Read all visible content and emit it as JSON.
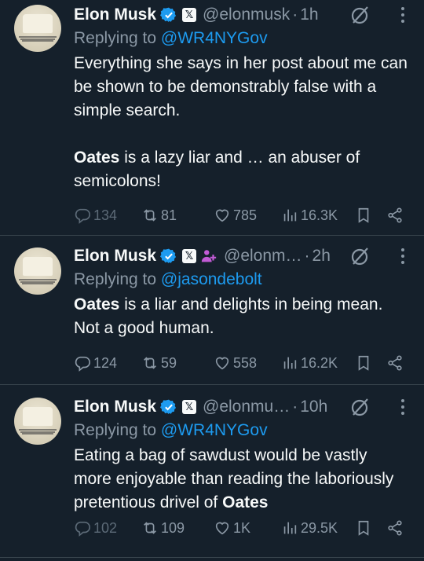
{
  "colors": {
    "background": "#15202b",
    "text": "#f7f9f9",
    "muted": "#8b98a5",
    "link": "#1d9bf0",
    "divider": "#38444d",
    "verified": "#1d9bf0"
  },
  "tweets": [
    {
      "author": "Elon Musk",
      "handle": "@elonmusk",
      "time": "1h",
      "separator": "·",
      "badges": [
        "verified-icon",
        "x-affiliate-icon"
      ],
      "reply_prefix": "Replying to ",
      "reply_to": "@WR4NYGov",
      "body_parts": [
        "Everything she says in her post about me can be shown to be demonstrably false with a simple search.",
        "Oates",
        " is a lazy liar and … an abuser of semicolons!"
      ],
      "stats": {
        "replies": "134",
        "retweets": "81",
        "likes": "785",
        "views": "16.3K"
      }
    },
    {
      "author": "Elon Musk",
      "handle": "@elonm…",
      "time": "2h",
      "separator": "·",
      "badges": [
        "verified-icon",
        "x-affiliate-icon",
        "group-icon"
      ],
      "reply_prefix": "Replying to ",
      "reply_to": "@jasondebolt",
      "body_parts": [
        "Oates",
        " is a liar and delights in being mean. Not a good human."
      ],
      "stats": {
        "replies": "124",
        "retweets": "59",
        "likes": "558",
        "views": "16.2K"
      }
    },
    {
      "author": "Elon Musk",
      "handle": "@elonmu…",
      "time": "10h",
      "separator": "·",
      "badges": [
        "verified-icon",
        "x-affiliate-icon"
      ],
      "reply_prefix": "Replying to ",
      "reply_to": "@WR4NYGov",
      "body_parts": [
        "Eating a bag of sawdust would be vastly more enjoyable than reading the laboriously pretentious drivel of ",
        "Oates"
      ],
      "stats": {
        "replies": "102",
        "retweets": "109",
        "likes": "1K",
        "views": "29.5K"
      }
    }
  ],
  "icons": {
    "x_badge_glyph": "𝕏",
    "grok": "grok-icon",
    "more": "more-icon",
    "reply": "reply-icon",
    "retweet": "retweet-icon",
    "like": "heart-icon",
    "views": "views-icon",
    "bookmark": "bookmark-icon",
    "share": "share-icon"
  }
}
